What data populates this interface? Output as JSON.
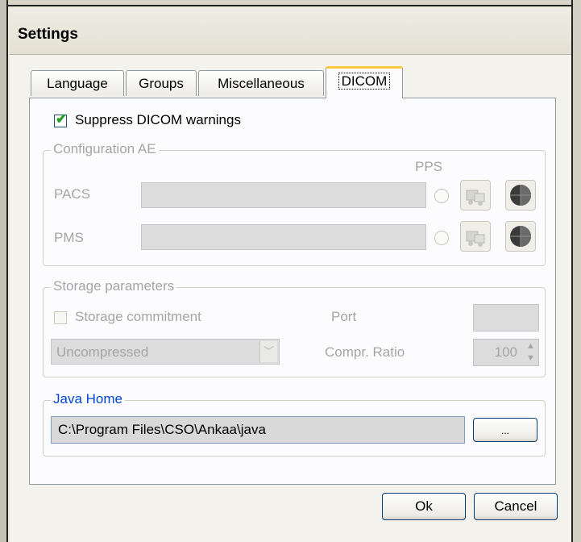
{
  "window": {
    "title": "Settings"
  },
  "tabs": [
    {
      "label": "Language"
    },
    {
      "label": "Groups"
    },
    {
      "label": "Miscellaneous"
    },
    {
      "label": "DICOM"
    }
  ],
  "dicom": {
    "suppress_label": "Suppress DICOM warnings",
    "suppress_checked": true,
    "config_ae": {
      "legend": "Configuration AE",
      "pps_label": "PPS",
      "pacs_label": "PACS",
      "pacs_value": "",
      "pms_label": "PMS",
      "pms_value": ""
    },
    "storage": {
      "legend": "Storage parameters",
      "commitment_label": "Storage commitment",
      "commitment_checked": false,
      "port_label": "Port",
      "port_value": "",
      "compression_value": "Uncompressed",
      "ratio_label": "Compr. Ratio",
      "ratio_value": "100"
    },
    "java_home": {
      "legend": "Java Home",
      "path": "C:\\Program Files\\CSO\\Ankaa\\java",
      "browse_label": "..."
    }
  },
  "buttons": {
    "ok": "Ok",
    "cancel": "Cancel"
  },
  "colors": {
    "accent_tab": "#ffc83c",
    "legend_blue": "#0046d5",
    "check_green": "#21a121"
  }
}
